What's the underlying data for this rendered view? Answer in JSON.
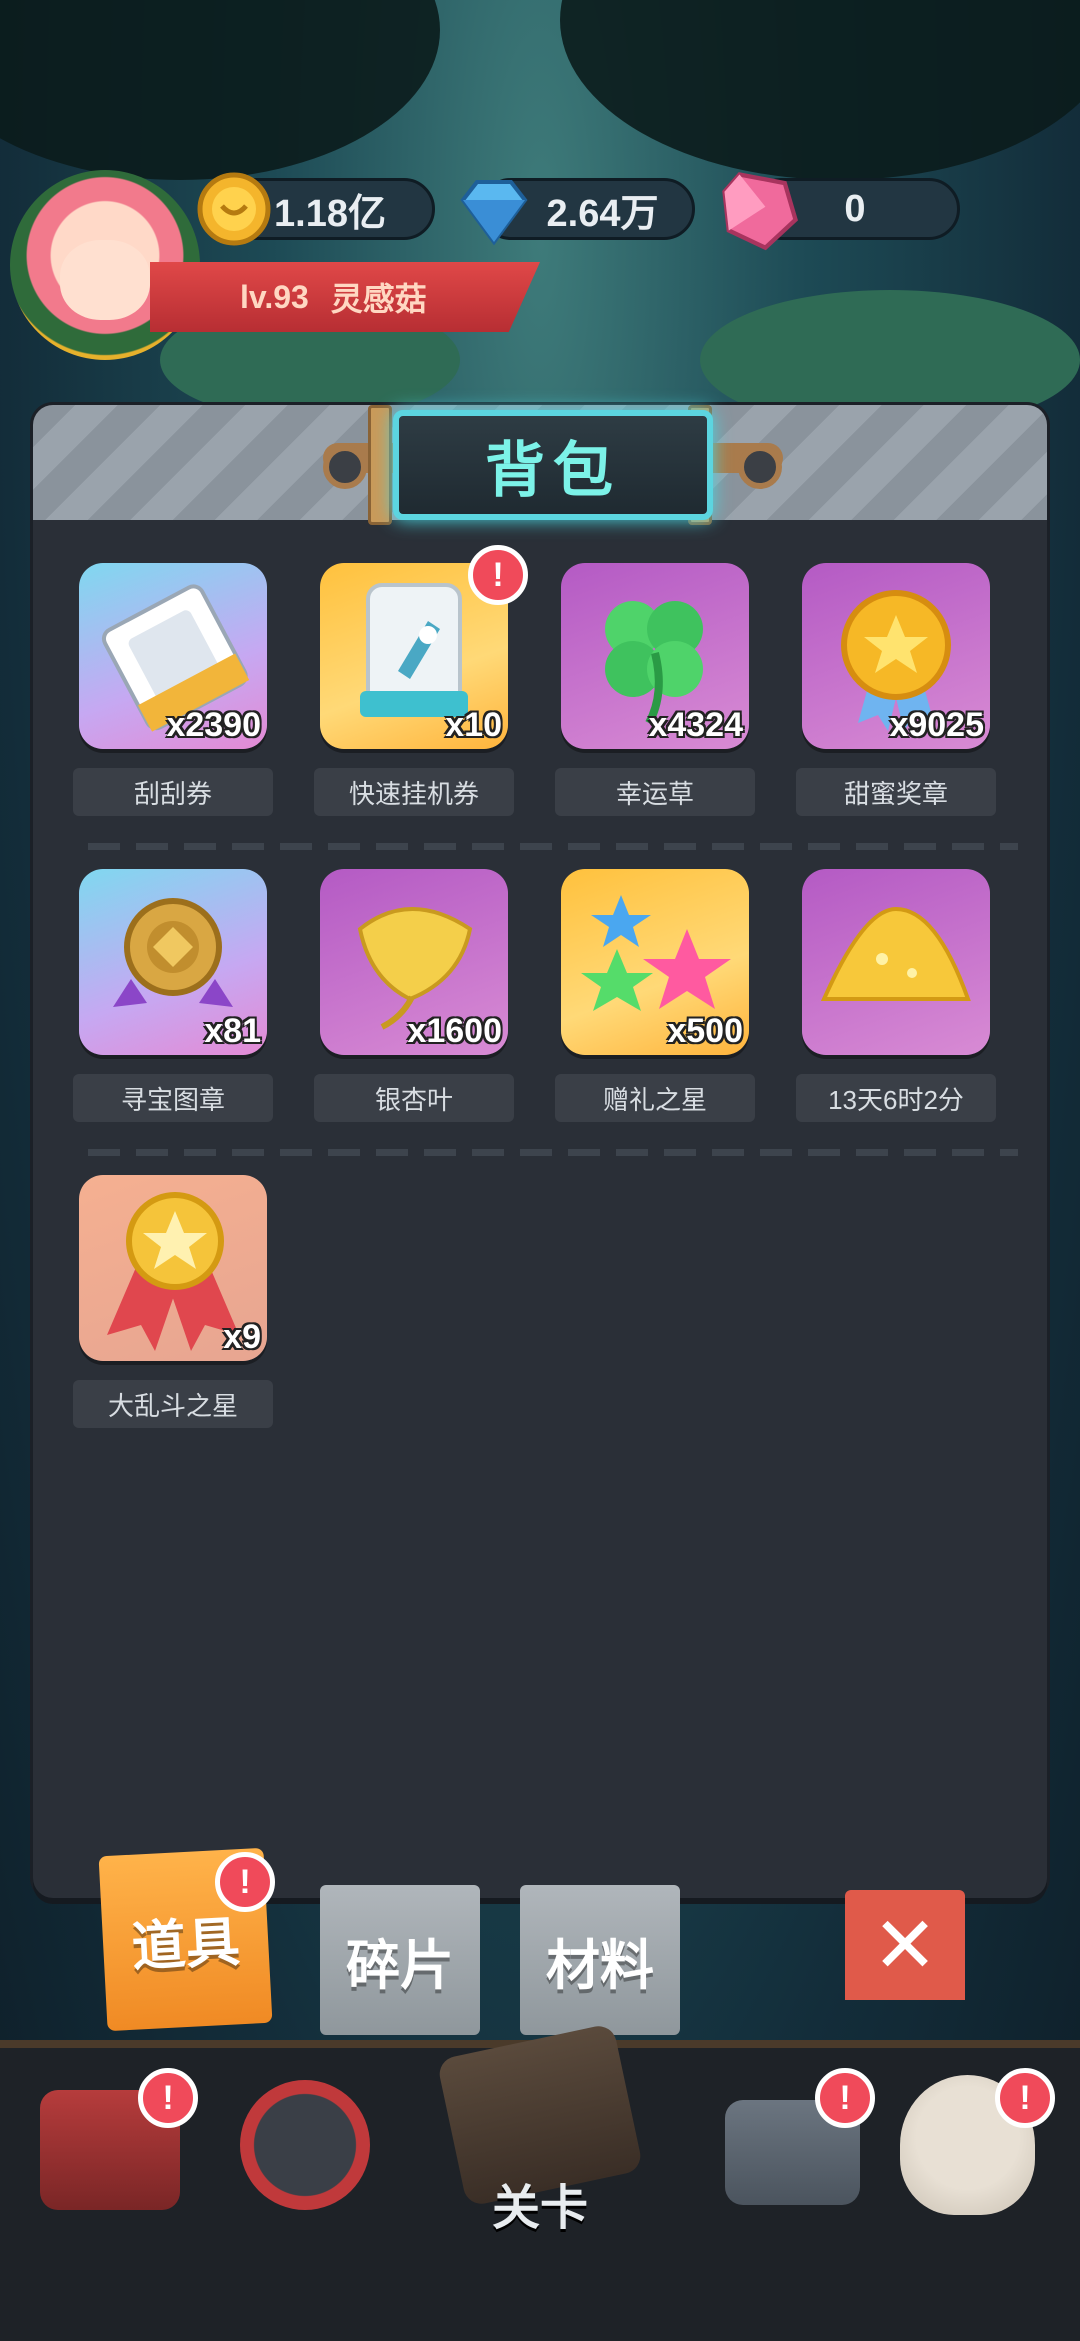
{
  "hud": {
    "coins": "1.18亿",
    "diamonds": "2.64万",
    "gems": "0",
    "level": "lv.93",
    "player_name": "灵感菇"
  },
  "panel": {
    "title": "背包"
  },
  "items": [
    {
      "name": "刮刮券",
      "count": "x2390",
      "style": "blue"
    },
    {
      "name": "快速挂机券",
      "count": "x10",
      "style": "orange"
    },
    {
      "name": "幸运草",
      "count": "x4324",
      "style": "pink"
    },
    {
      "name": "甜蜜奖章",
      "count": "x9025",
      "style": "pink"
    },
    {
      "name": "寻宝图章",
      "count": "x81",
      "style": "blue"
    },
    {
      "name": "银杏叶",
      "count": "x1600",
      "style": "pink"
    },
    {
      "name": "赠礼之星",
      "count": "x500",
      "style": "orange"
    },
    {
      "name": "13天6时2分",
      "count": "",
      "style": "pink"
    },
    {
      "name": "大乱斗之星",
      "count": "x9",
      "style": "salmon"
    }
  ],
  "tabs": {
    "props": "道具",
    "fragments": "碎片",
    "materials": "材料"
  },
  "badge_mark": "!",
  "close_mark": "✕",
  "nav": {
    "stage_label": "关卡"
  },
  "colors": {
    "accent_teal": "#7cf2e8",
    "badge_red": "#f04a5a",
    "tab_orange": "#f08a24",
    "panel_bg": "#2a2f37"
  }
}
